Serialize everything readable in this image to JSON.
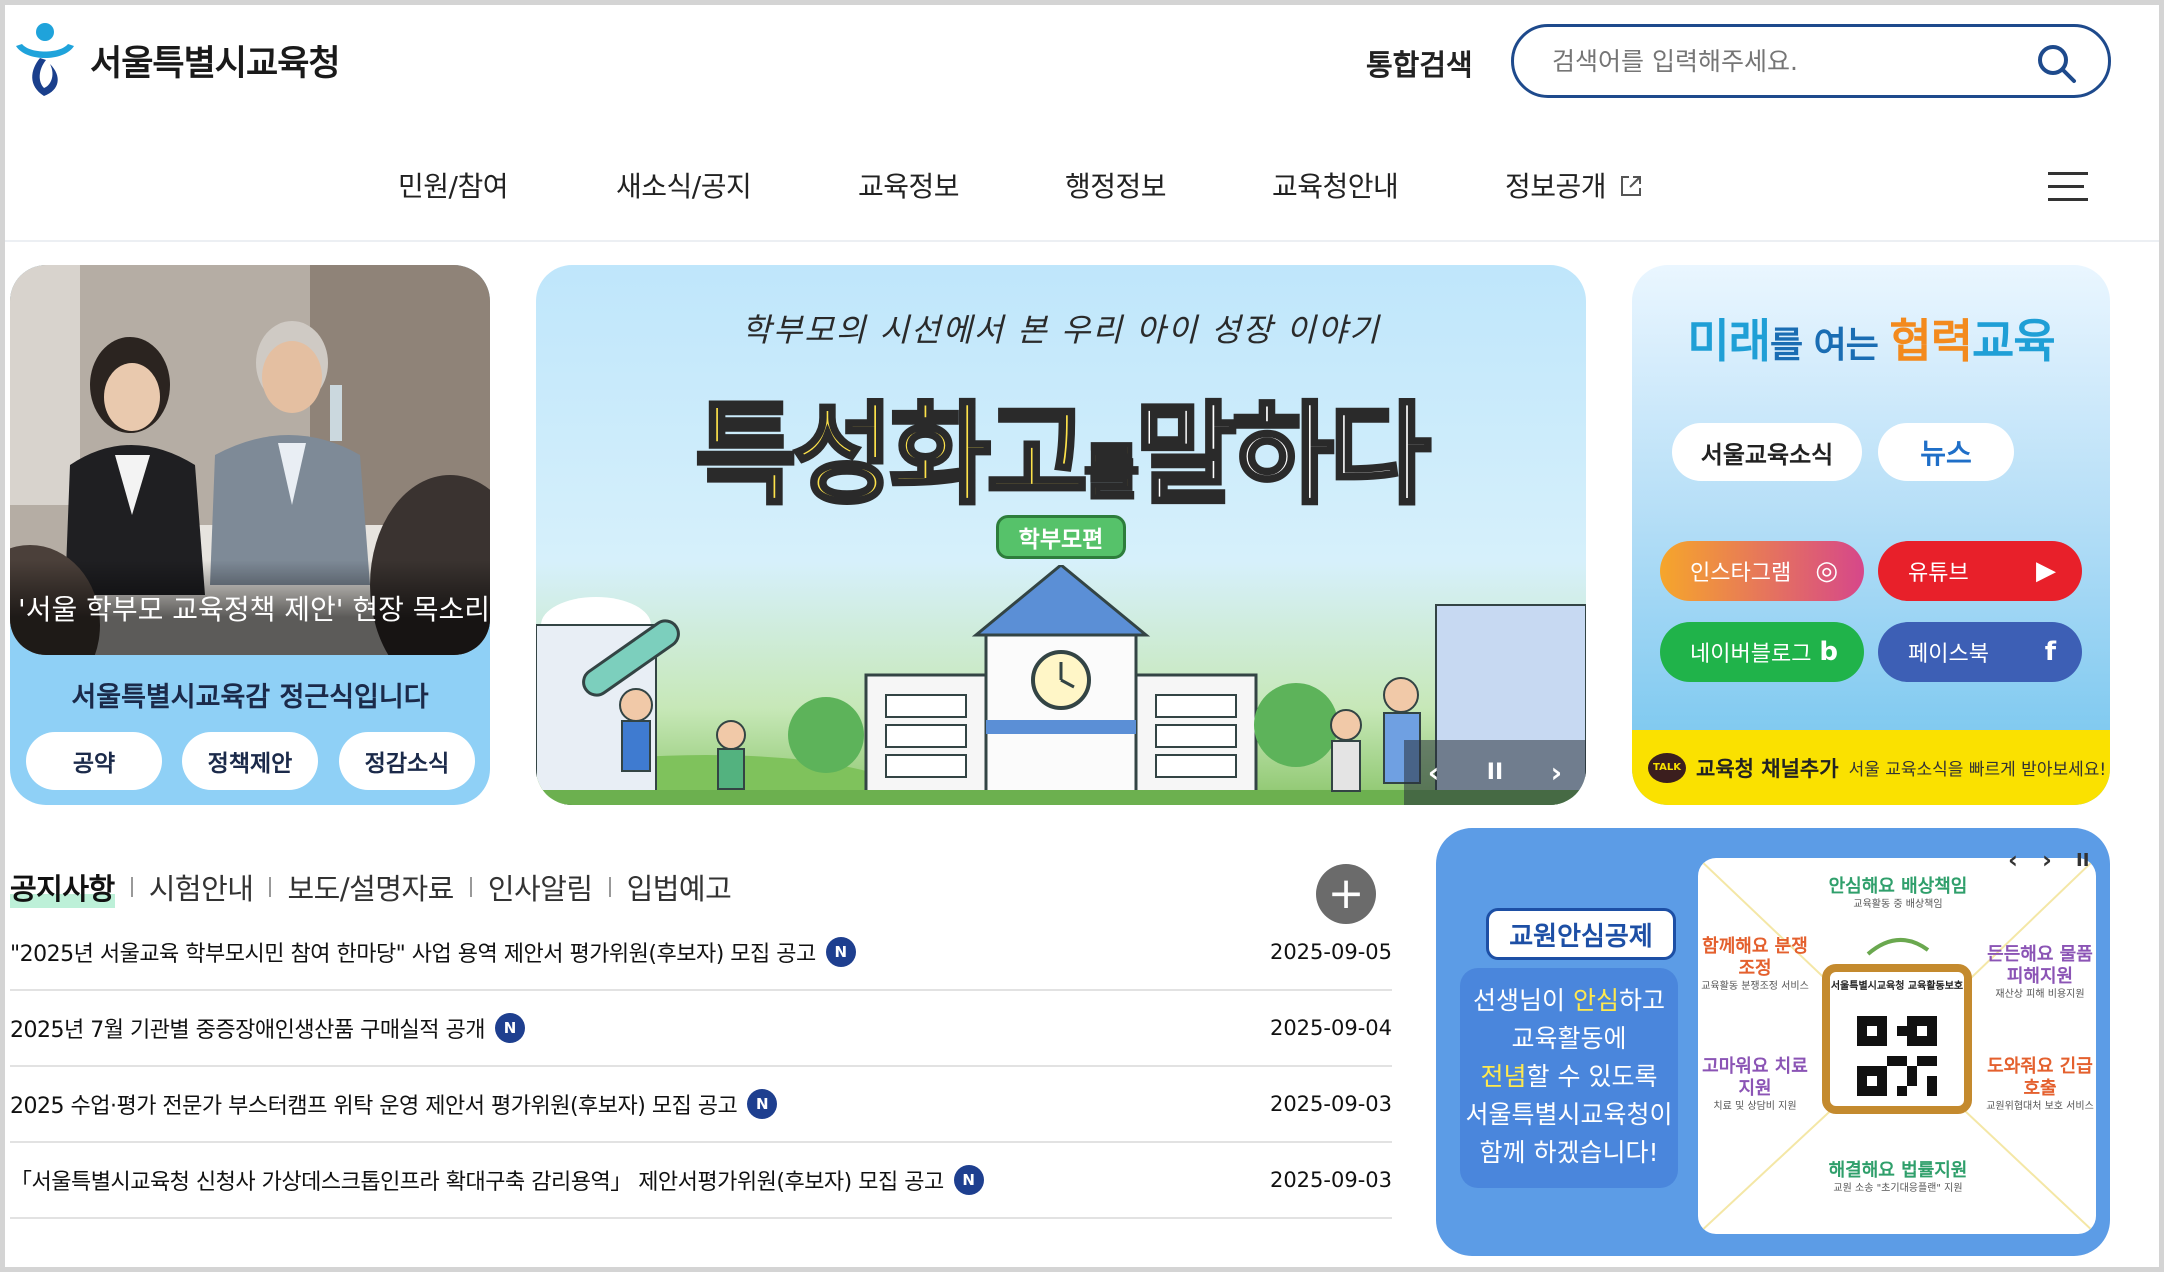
{
  "header": {
    "logo_text": "서울특별시교육청",
    "search_label": "통합검색",
    "search_placeholder": "검색어를 입력해주세요."
  },
  "nav": {
    "items": [
      {
        "label": "민원/참여"
      },
      {
        "label": "새소식/공지"
      },
      {
        "label": "교육정보"
      },
      {
        "label": "행정정보"
      },
      {
        "label": "교육청안내"
      },
      {
        "label": "정보공개"
      }
    ]
  },
  "left_card": {
    "photo_caption": "'서울 학부모 교육정책 제안' 현장 목소리 ...",
    "subtitle": "서울특별시교육감 정근식입니다",
    "buttons": [
      {
        "label": "공약"
      },
      {
        "label": "정책제안"
      },
      {
        "label": "정감소식"
      }
    ]
  },
  "banner": {
    "subtitle": "학부모의 시선에서 본 우리 아이 성장 이야기",
    "title_part1": "특성화고",
    "title_part2": "를",
    "title_part3": "말하다",
    "tag": "학부모편",
    "prev_label": "‹",
    "pause_label": "II",
    "next_label": "›"
  },
  "right_card": {
    "title_part1": "미래",
    "title_part2": "를 여는 ",
    "title_part3": "협력",
    "title_part4": "교육",
    "pill_news_letter": "서울교육소식",
    "pill_news": "뉴스",
    "sns": [
      {
        "label": "인스타그램",
        "icon": "instagram-icon",
        "glyph": "◎",
        "color": "#f0882e"
      },
      {
        "label": "유튜브",
        "icon": "youtube-icon",
        "glyph": "▶",
        "color": "#e8202a"
      },
      {
        "label": "네이버블로그",
        "icon": "naver-blog-icon",
        "glyph": "b",
        "color": "#20b34a"
      },
      {
        "label": "페이스북",
        "icon": "facebook-icon",
        "glyph": "f",
        "color": "#3d5fb5"
      }
    ],
    "kakao_badge": "TALK",
    "kakao_title": "교육청 채널추가",
    "kakao_desc": "서울 교육소식을 빠르게 받아보세요!"
  },
  "notice": {
    "tabs": [
      {
        "label": "공지사항",
        "active": true
      },
      {
        "label": "시험안내",
        "active": false
      },
      {
        "label": "보도/설명자료",
        "active": false
      },
      {
        "label": "인사알림",
        "active": false
      },
      {
        "label": "입법예고",
        "active": false
      }
    ],
    "more_label": "+",
    "badge_label": "N",
    "rows": [
      {
        "title": "\"2025년 서울교육 학부모시민 참여 한마당\" 사업 용역 제안서 평가위원(후보자) 모집 공고",
        "date": "2025-09-05"
      },
      {
        "title": "2025년 7월 기관별 중증장애인생산품 구매실적 공개",
        "date": "2025-09-04"
      },
      {
        "title": "2025 수업·평가 전문가 부스터캠프 위탁 운영 제안서 평가위원(후보자) 모집 공고",
        "date": "2025-09-03"
      },
      {
        "title": "「서울특별시교육청 신청사 가상데스크톱인프라 확대구축 감리용역」 제안서평가위원(후보자) 모집 공고",
        "date": "2025-09-03"
      }
    ]
  },
  "teacher": {
    "title": "교원안심공제",
    "line1_a": "선생님이 ",
    "line1_hl": "안심",
    "line1_b": "하고",
    "line2": "교육활동에",
    "line3_hl": "전념",
    "line3_b": "할 수 있도록",
    "line4": "서울특별시교육청이",
    "line5": "함께 하겠습니다!",
    "ctrl_prev": "‹",
    "ctrl_next": "›",
    "ctrl_pause": "II",
    "card": {
      "top_title": "안심해요 배상책임",
      "top_sub": "교육활동 중 배상책임",
      "left1_title": "함께해요 분쟁조정",
      "left1_sub": "교육활동 분쟁조정 서비스",
      "left2_title": "고마워요 치료지원",
      "left2_sub": "치료 및 상담비 지원",
      "right1_title": "든든해요 물품피해지원",
      "right1_sub": "재산상 피해 비용지원",
      "right2_title": "도와줘요 긴급호출",
      "right2_sub": "교원위협대처 보호 서비스",
      "bottom_title": "해결해요 법률지원",
      "bottom_sub": "교원 소송 \"초기대응플랜\" 지원",
      "center_title": "서울특별시교육청 교육활동보호"
    }
  }
}
